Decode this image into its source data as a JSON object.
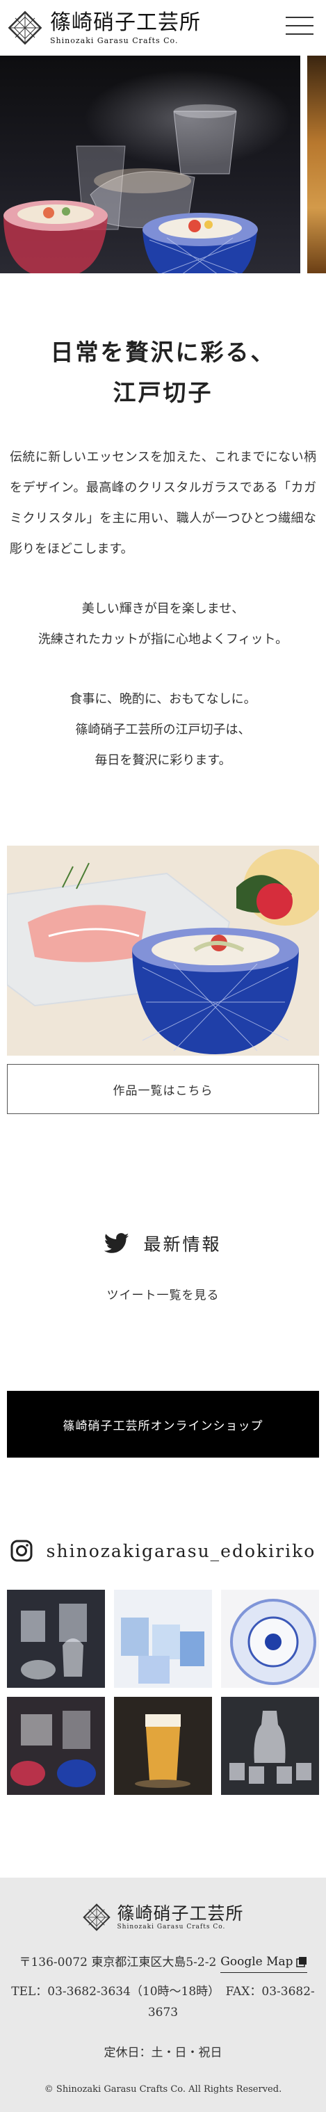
{
  "header": {
    "logo_ja": "篠崎硝子工芸所",
    "logo_en": "Shinozaki Garasu Crafts Co."
  },
  "headline": {
    "line1": "日常を贅沢に彩る、",
    "line2": "江戸切子"
  },
  "intro": "伝統に新しいエッセンスを加えた、これまでにない柄をデザイン。最高峰のクリスタルガラスである「カガミクリスタル」を主に用い、職人が一つひとつ繊細な彫りをほどこします。",
  "para2": [
    "美しい輝きが目を楽しませ、",
    "洗練されたカットが指に心地よくフィット。"
  ],
  "para3": [
    "食事に、晩酌に、おもてなしに。",
    "篠崎硝子工芸所の江戸切子は、",
    "毎日を贅沢に彩ります。"
  ],
  "works_button": "作品一覧はこちら",
  "news": {
    "title": "最新情報",
    "link": "ツイート一覧を見る"
  },
  "shop_button": "篠崎硝子工芸所オンラインショップ",
  "instagram": {
    "handle": "shinozakigarasu_edokiriko"
  },
  "footer": {
    "logo_ja": "篠崎硝子工芸所",
    "logo_en": "Shinozaki Garasu Crafts Co.",
    "address": "〒136-0072 東京都江東区大島5-2-2",
    "map_link": "Google Map",
    "tel_fax": "TEL：03-3682-3634（10時〜18時）　FAX：03-3682-3673",
    "closed": "定休日：土・日・祝日",
    "copyright": "© Shinozaki Garasu Crafts Co. All Rights Reserved."
  },
  "colors": {
    "footer_bg": "#e9e9e9",
    "shop_bg": "#000000",
    "kiriko_blue": "#1f3fa8",
    "kiriko_red": "#b8324a"
  }
}
